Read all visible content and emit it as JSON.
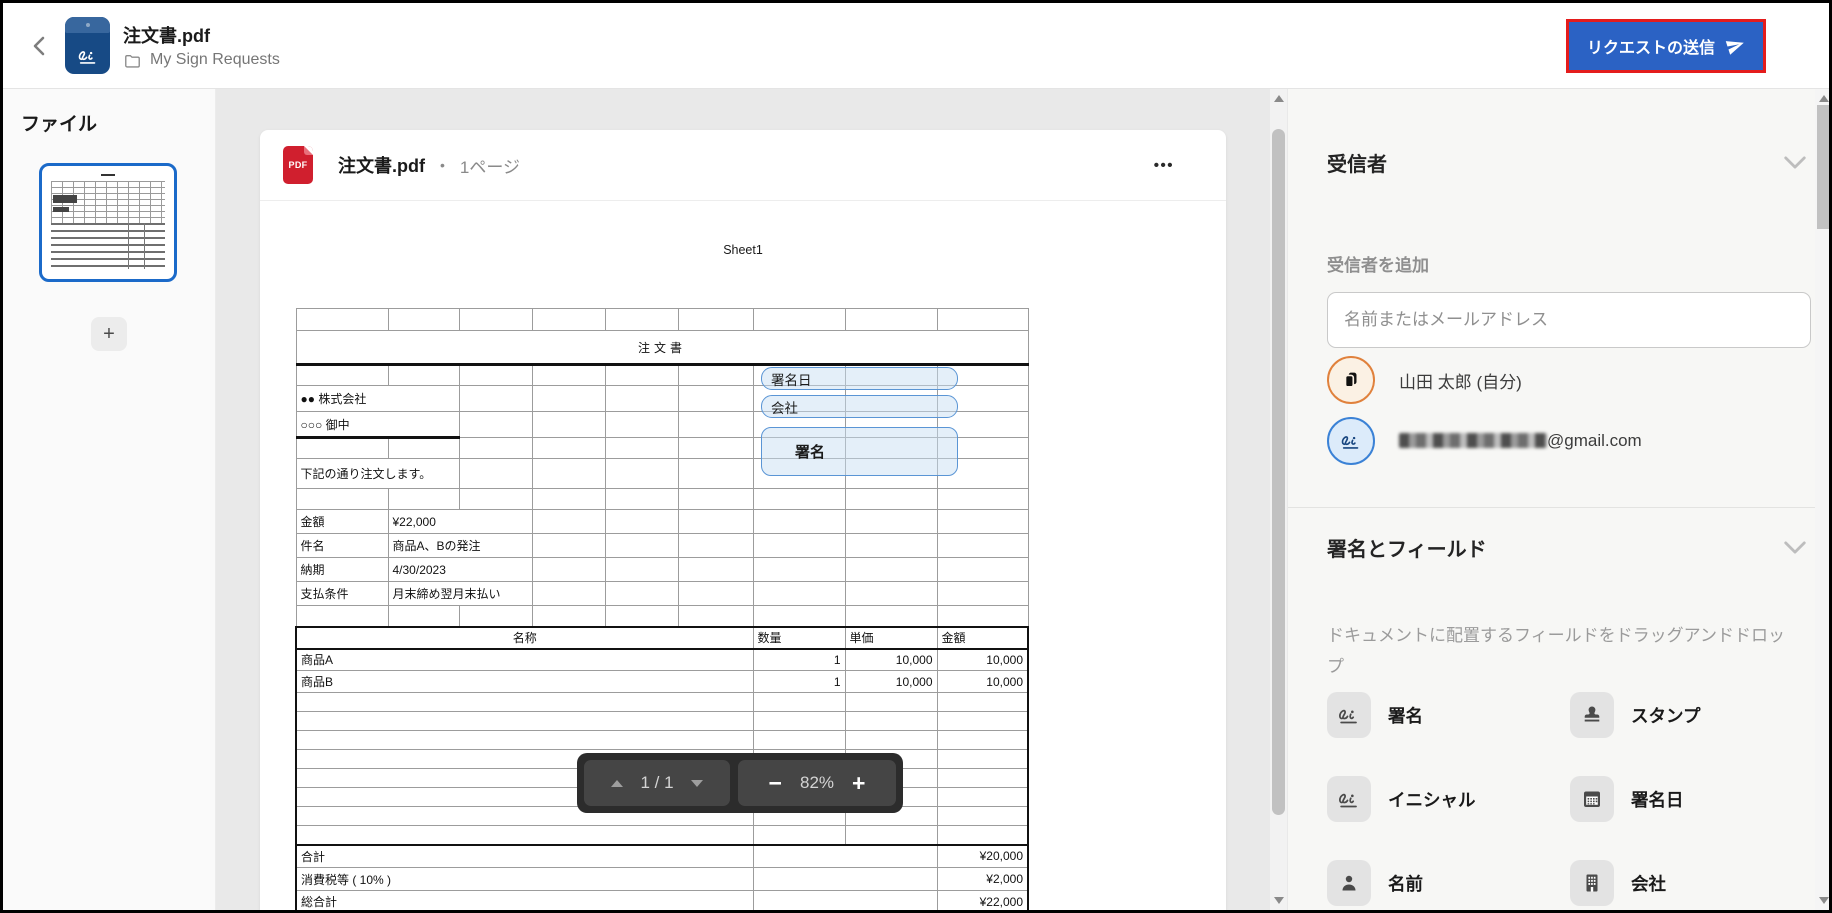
{
  "header": {
    "title": "注文書.pdf",
    "breadcrumb": "My Sign Requests",
    "send_button": "リクエストの送信"
  },
  "files_panel": {
    "title": "ファイル",
    "add_button": "+"
  },
  "preview": {
    "file_name": "注文書.pdf",
    "separator": "•",
    "page_count": "1ページ",
    "menu": "•••",
    "toolbar": {
      "page_indicator": "1 / 1",
      "zoom_out": "−",
      "zoom_level": "82%",
      "zoom_in": "+"
    }
  },
  "document": {
    "sheet_label": "Sheet1",
    "title": "注文書",
    "company_from": "●● 株式会社",
    "company_to": "○○○ 御中",
    "intro": "下記の通り注文します。",
    "info_rows": [
      {
        "label": "金額",
        "value": "¥22,000"
      },
      {
        "label": "件名",
        "value": "商品A、Bの発注"
      },
      {
        "label": "納期",
        "value": "4/30/2023"
      },
      {
        "label": "支払条件",
        "value": "月末締め翌月末払い"
      }
    ],
    "items_header": {
      "name": "名称",
      "qty": "数量",
      "unit_price": "単価",
      "amount": "金額"
    },
    "items": [
      {
        "name": "商品A",
        "qty": "1",
        "unit_price": "10,000",
        "amount": "10,000"
      },
      {
        "name": "商品B",
        "qty": "1",
        "unit_price": "10,000",
        "amount": "10,000"
      }
    ],
    "totals": [
      {
        "label": "合計",
        "value": "¥20,000"
      },
      {
        "label": "消費税等 ( 10% )",
        "value": "¥2,000"
      },
      {
        "label": "総合計",
        "value": "¥22,000"
      }
    ],
    "fields": {
      "sign_date": "署名日",
      "company": "会社",
      "signature": "署名"
    }
  },
  "recipients_panel": {
    "title": "受信者",
    "add_label": "受信者を追加",
    "input_placeholder": "名前またはメールアドレス",
    "recipients": [
      {
        "name": "山田 太郎 (自分)"
      },
      {
        "email_visible": "@gmail.com",
        "prefix_redacted": true
      }
    ]
  },
  "fields_panel": {
    "title": "署名とフィールド",
    "hint": "ドキュメントに配置するフィールドをドラッグアンドドロップ",
    "fields": [
      {
        "label": "署名"
      },
      {
        "label": "スタンプ"
      },
      {
        "label": "イニシャル"
      },
      {
        "label": "署名日"
      },
      {
        "label": "名前"
      },
      {
        "label": "会社"
      }
    ]
  },
  "colors": {
    "accent_blue": "#2b62c4",
    "brand_navy": "#174a85",
    "highlight_red": "#e41c1c",
    "pdf_red": "#d01f2e",
    "selection_blue": "#1b6ac9",
    "field_border": "#5a95d5",
    "field_fill": "#dcebf8"
  }
}
